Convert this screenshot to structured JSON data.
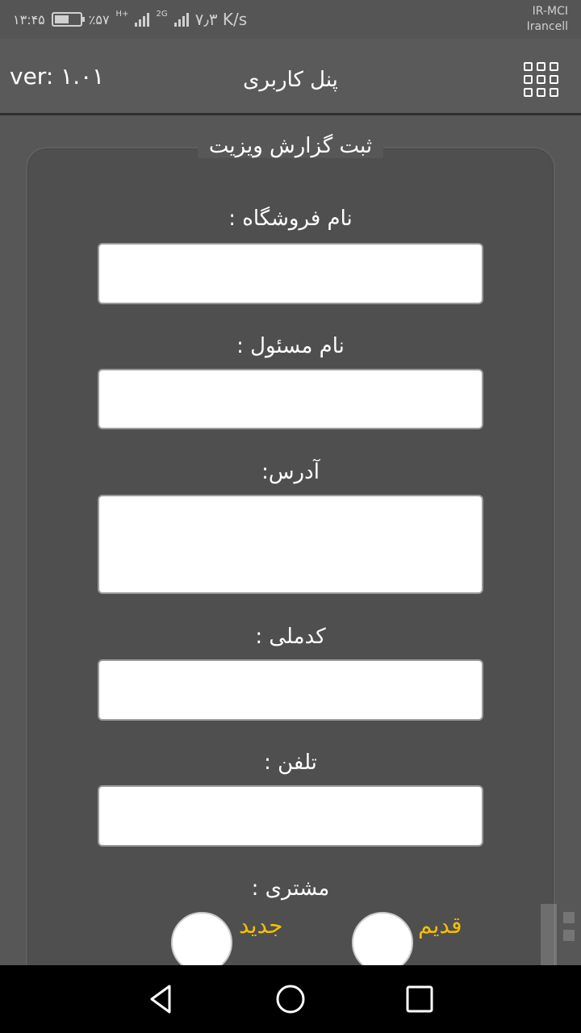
{
  "status_bar": {
    "time": "۱۳:۴۵",
    "battery_percent": "٪۵۷",
    "battery_level": 0.57,
    "net_tag_1": "H+",
    "net_tag_2": "2G",
    "speed": "۷٫۳ K/s",
    "carrier_1": "IR-MCI",
    "carrier_2": "Irancell"
  },
  "header": {
    "version": "ver: ۱.۰۱",
    "title": "پنل کاربری",
    "menu_icon": "grid-menu-icon"
  },
  "form": {
    "legend": "ثبت گزارش ویزیت",
    "store_name_label": "نام فروشگاه :",
    "store_name_value": "",
    "manager_name_label": "نام مسئول :",
    "manager_name_value": "",
    "address_label": "آدرس:",
    "address_value": "",
    "national_code_label": "کدملی :",
    "national_code_value": "",
    "phone_label": "تلفن :",
    "phone_value": "",
    "customer_label": "مشتری :",
    "customer_options": [
      {
        "label": "قدیم",
        "selected": false
      },
      {
        "label": "جدید",
        "selected": false
      }
    ]
  },
  "nav": {
    "back_icon": "back-triangle-icon",
    "home_icon": "home-circle-icon",
    "recents_icon": "recents-square-icon"
  },
  "colors": {
    "background": "#575757",
    "accent": "#f5c000",
    "navbar": "#000000"
  }
}
